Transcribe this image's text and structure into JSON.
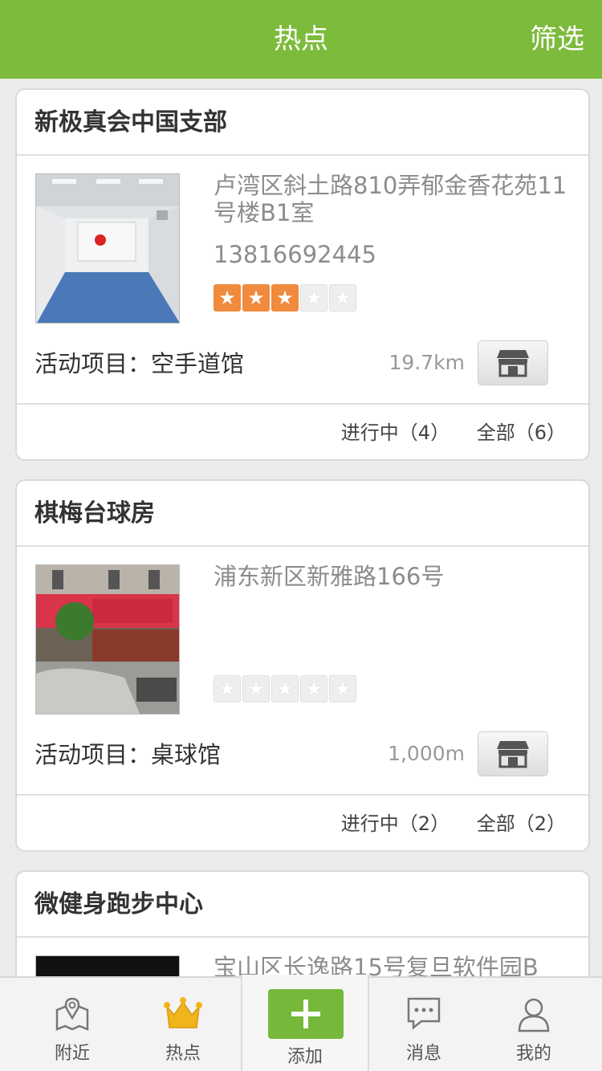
{
  "header": {
    "title": "热点",
    "filter_label": "筛选"
  },
  "cards": [
    {
      "name": "新极真会中国支部",
      "address": "卢湾区斜土路810弄郁金香花苑11号楼B1室",
      "phone": "13816692445",
      "rating": 3,
      "activity": "活动项目：空手道馆",
      "distance": "19.7km",
      "status_ongoing": "进行中（4）",
      "status_all": "全部（6）"
    },
    {
      "name": "棋梅台球房",
      "address": "浦东新区新雅路166号",
      "phone": "",
      "rating": 0,
      "activity": "活动项目：桌球馆",
      "distance": "1,000m",
      "status_ongoing": "进行中（2）",
      "status_all": "全部（2）"
    },
    {
      "name": "微健身跑步中心",
      "address": "宝山区长逸路15号复旦软件园B"
    }
  ],
  "tabbar": {
    "nearby": "附近",
    "hot": "热点",
    "add": "添加",
    "messages": "消息",
    "mine": "我的"
  },
  "colors": {
    "brand_green": "#7dbb3c",
    "star_orange": "#f08a3c"
  },
  "icons": [
    "map-pin-icon",
    "crown-icon",
    "plus-icon",
    "chat-icon",
    "user-icon",
    "store-icon",
    "star-icon"
  ]
}
